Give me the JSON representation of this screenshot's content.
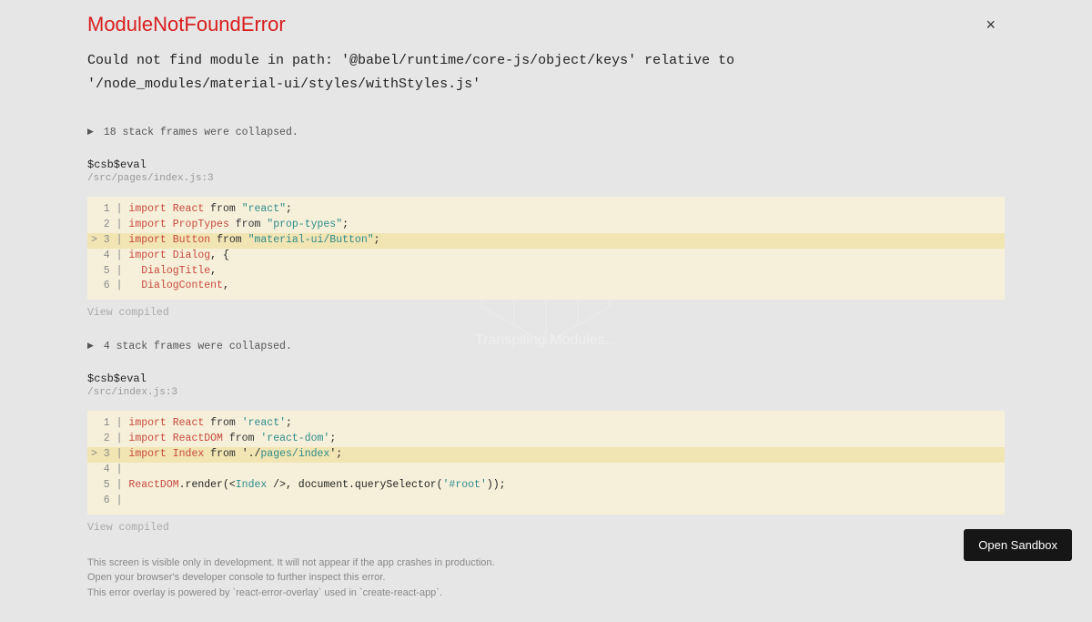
{
  "background": {
    "status_text": "Transpiling Modules..."
  },
  "close_label": "×",
  "error": {
    "title": "ModuleNotFoundError",
    "message": "Could not find module in path: '@babel/runtime/core-js/object/keys' relative to '/node_modules/material-ui/styles/withStyles.js'"
  },
  "frames": [
    {
      "collapsed": "18 stack frames were collapsed.",
      "name": "$csb$eval",
      "path": "/src/pages/index.js:3",
      "view_compiled": "View compiled",
      "code": [
        {
          "n": "1",
          "hl": false,
          "import": "import",
          "ident": "React",
          "from": "from",
          "str": "\"react\"",
          "punc": ";"
        },
        {
          "n": "2",
          "hl": false,
          "import": "import",
          "ident": "PropTypes",
          "from": "from",
          "str": "\"prop-types\"",
          "punc": ";"
        },
        {
          "n": "3",
          "hl": true,
          "import": "import",
          "ident": "Button",
          "from": "from",
          "str": "\"material-ui/Button\"",
          "punc": ";"
        },
        {
          "n": "4",
          "hl": false,
          "import": "import",
          "ident": "Dialog",
          "extra": ", {"
        },
        {
          "n": "5",
          "hl": false,
          "indent_ident": "DialogTitle",
          "indent_punc": ","
        },
        {
          "n": "6",
          "hl": false,
          "indent_ident": "DialogContent",
          "indent_punc": ","
        }
      ]
    },
    {
      "collapsed": "4 stack frames were collapsed.",
      "name": "$csb$eval",
      "path": "/src/index.js:3",
      "view_compiled": "View compiled",
      "code": [
        {
          "n": "1",
          "hl": false,
          "import": "import",
          "ident": "React",
          "from": "from",
          "str": "'react'",
          "punc": ";"
        },
        {
          "n": "2",
          "hl": false,
          "import": "import",
          "ident": "ReactDOM",
          "from": "from",
          "str": "'react-dom'",
          "punc": ";"
        },
        {
          "n": "3",
          "hl": true,
          "import": "import",
          "ident": "Index",
          "from": "from",
          "str_pre": "'./",
          "str_mid": "pages/index",
          "str_post": "'",
          "punc": ";"
        },
        {
          "n": "4",
          "hl": false,
          "empty": true
        },
        {
          "n": "5",
          "hl": false,
          "react_render": true
        },
        {
          "n": "6",
          "hl": false,
          "empty": true
        }
      ],
      "render_line": {
        "ReactDOM": "ReactDOM",
        "render": ".render(",
        "jsx_open": "<",
        "jsx_name": "Index",
        "jsx_close": " />",
        "mid": ", document.querySelector(",
        "root": "'#root'",
        "end": "));"
      }
    }
  ],
  "footer": {
    "line1": "This screen is visible only in development. It will not appear if the app crashes in production.",
    "line2": "Open your browser's developer console to further inspect this error.",
    "line3": "This error overlay is powered by `react-error-overlay` used in `create-react-app`."
  },
  "open_sandbox": "Open Sandbox"
}
